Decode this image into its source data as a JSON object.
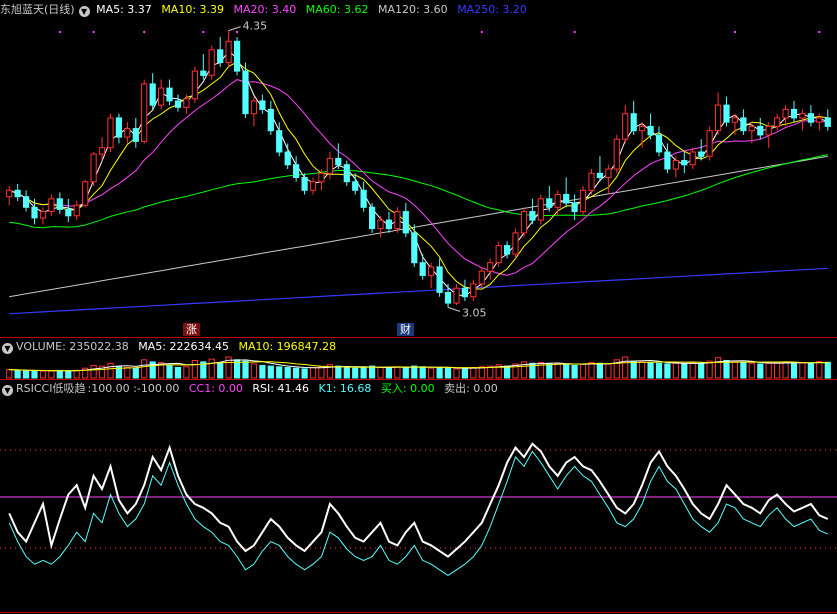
{
  "colors": {
    "up": "#ff3030",
    "down": "#54ffff",
    "ma5": "#ffffff",
    "ma10": "#ffff00",
    "ma20": "#ff44ff",
    "ma60": "#00ff00",
    "ma120": "#c8c8c8",
    "ma250": "#3838ff",
    "rsi": "#ffffff",
    "k1": "#54ffff",
    "cc1": "#ff44ff",
    "divider": "#c00000"
  },
  "main": {
    "title": "东旭蓝天(日线)",
    "ma5": "MA5: 3.37",
    "ma10": "MA10: 3.39",
    "ma20": "MA20: 3.40",
    "ma60": "MA60: 3.62",
    "ma120": "MA120: 3.60",
    "ma250": "MA250: 3.20",
    "high_label": "4.35",
    "low_label": "3.05",
    "tag_up": "涨",
    "tag_fin": "财"
  },
  "volume": {
    "title": "VOLUME: 235022.38",
    "ma5": "MA5: 222634.45",
    "ma10": "MA10: 196847.28"
  },
  "indicator": {
    "title": "RSICCI低吸趋",
    "params": ":100.00 :-100.00",
    "cc1": "CC1: 0.00",
    "rsi": "RSI: 41.46",
    "k1": "K1: 16.68",
    "buy": "买入: 0.00",
    "sell": "卖出: 0.00"
  },
  "chart_data": [
    {
      "type": "candlestick",
      "series_note": "approximate daily OHLC read from price chart",
      "ohlc": [
        [
          3.57,
          3.62,
          3.53,
          3.6
        ],
        [
          3.6,
          3.63,
          3.55,
          3.57
        ],
        [
          3.57,
          3.6,
          3.5,
          3.52
        ],
        [
          3.52,
          3.56,
          3.44,
          3.47
        ],
        [
          3.47,
          3.52,
          3.44,
          3.5
        ],
        [
          3.5,
          3.58,
          3.48,
          3.56
        ],
        [
          3.56,
          3.59,
          3.49,
          3.51
        ],
        [
          3.51,
          3.56,
          3.45,
          3.48
        ],
        [
          3.48,
          3.55,
          3.46,
          3.53
        ],
        [
          3.53,
          3.65,
          3.52,
          3.64
        ],
        [
          3.64,
          3.78,
          3.62,
          3.77
        ],
        [
          3.77,
          3.85,
          3.74,
          3.8
        ],
        [
          3.8,
          3.96,
          3.78,
          3.94
        ],
        [
          3.94,
          3.96,
          3.82,
          3.85
        ],
        [
          3.85,
          3.92,
          3.82,
          3.89
        ],
        [
          3.89,
          3.94,
          3.8,
          3.83
        ],
        [
          3.83,
          4.12,
          3.82,
          4.1
        ],
        [
          4.1,
          4.15,
          3.98,
          4.0
        ],
        [
          4.0,
          4.12,
          3.98,
          4.08
        ],
        [
          4.08,
          4.12,
          4.0,
          4.02
        ],
        [
          4.02,
          4.05,
          3.97,
          3.99
        ],
        [
          3.99,
          4.05,
          3.96,
          4.03
        ],
        [
          4.03,
          4.18,
          4.01,
          4.16
        ],
        [
          4.16,
          4.24,
          4.12,
          4.14
        ],
        [
          4.14,
          4.28,
          4.12,
          4.26
        ],
        [
          4.26,
          4.32,
          4.18,
          4.2
        ],
        [
          4.2,
          4.35,
          4.18,
          4.3
        ],
        [
          4.3,
          4.32,
          4.14,
          4.16
        ],
        [
          4.16,
          4.2,
          3.94,
          3.96
        ],
        [
          3.96,
          4.04,
          3.9,
          4.02
        ],
        [
          4.02,
          4.05,
          3.96,
          3.98
        ],
        [
          3.98,
          4.02,
          3.86,
          3.88
        ],
        [
          3.88,
          3.92,
          3.76,
          3.78
        ],
        [
          3.78,
          3.82,
          3.7,
          3.72
        ],
        [
          3.72,
          3.76,
          3.64,
          3.66
        ],
        [
          3.66,
          3.68,
          3.58,
          3.6
        ],
        [
          3.6,
          3.66,
          3.58,
          3.64
        ],
        [
          3.64,
          3.7,
          3.6,
          3.68
        ],
        [
          3.68,
          3.78,
          3.65,
          3.75
        ],
        [
          3.75,
          3.82,
          3.7,
          3.72
        ],
        [
          3.72,
          3.74,
          3.62,
          3.64
        ],
        [
          3.64,
          3.68,
          3.58,
          3.6
        ],
        [
          3.6,
          3.64,
          3.5,
          3.52
        ],
        [
          3.52,
          3.54,
          3.4,
          3.42
        ],
        [
          3.42,
          3.48,
          3.38,
          3.46
        ],
        [
          3.46,
          3.5,
          3.4,
          3.42
        ],
        [
          3.42,
          3.52,
          3.4,
          3.5
        ],
        [
          3.5,
          3.54,
          3.38,
          3.4
        ],
        [
          3.4,
          3.44,
          3.24,
          3.26
        ],
        [
          3.26,
          3.3,
          3.18,
          3.2
        ],
        [
          3.2,
          3.26,
          3.14,
          3.24
        ],
        [
          3.24,
          3.28,
          3.1,
          3.12
        ],
        [
          3.12,
          3.16,
          3.05,
          3.07
        ],
        [
          3.07,
          3.16,
          3.06,
          3.14
        ],
        [
          3.14,
          3.18,
          3.08,
          3.1
        ],
        [
          3.1,
          3.18,
          3.08,
          3.16
        ],
        [
          3.16,
          3.24,
          3.14,
          3.22
        ],
        [
          3.22,
          3.28,
          3.18,
          3.26
        ],
        [
          3.26,
          3.36,
          3.24,
          3.34
        ],
        [
          3.34,
          3.36,
          3.28,
          3.3
        ],
        [
          3.3,
          3.42,
          3.28,
          3.4
        ],
        [
          3.4,
          3.52,
          3.38,
          3.5
        ],
        [
          3.5,
          3.56,
          3.44,
          3.46
        ],
        [
          3.46,
          3.58,
          3.44,
          3.56
        ],
        [
          3.56,
          3.62,
          3.5,
          3.52
        ],
        [
          3.52,
          3.6,
          3.48,
          3.58
        ],
        [
          3.58,
          3.66,
          3.52,
          3.54
        ],
        [
          3.54,
          3.58,
          3.46,
          3.5
        ],
        [
          3.5,
          3.62,
          3.48,
          3.6
        ],
        [
          3.6,
          3.7,
          3.58,
          3.68
        ],
        [
          3.68,
          3.76,
          3.64,
          3.66
        ],
        [
          3.66,
          3.72,
          3.58,
          3.7
        ],
        [
          3.7,
          3.86,
          3.68,
          3.84
        ],
        [
          3.84,
          4.0,
          3.82,
          3.96
        ],
        [
          3.96,
          4.02,
          3.86,
          3.88
        ],
        [
          3.88,
          3.92,
          3.8,
          3.9
        ],
        [
          3.9,
          3.96,
          3.84,
          3.86
        ],
        [
          3.86,
          3.9,
          3.76,
          3.78
        ],
        [
          3.78,
          3.82,
          3.68,
          3.7
        ],
        [
          3.7,
          3.76,
          3.66,
          3.74
        ],
        [
          3.74,
          3.78,
          3.68,
          3.72
        ],
        [
          3.72,
          3.8,
          3.7,
          3.78
        ],
        [
          3.78,
          3.84,
          3.74,
          3.76
        ],
        [
          3.76,
          3.9,
          3.74,
          3.88
        ],
        [
          3.88,
          4.06,
          3.86,
          4.0
        ],
        [
          4.0,
          4.04,
          3.9,
          3.92
        ],
        [
          3.92,
          3.96,
          3.86,
          3.94
        ],
        [
          3.94,
          3.98,
          3.86,
          3.88
        ],
        [
          3.88,
          3.92,
          3.82,
          3.9
        ],
        [
          3.9,
          3.94,
          3.84,
          3.86
        ],
        [
          3.86,
          3.92,
          3.8,
          3.9
        ],
        [
          3.9,
          3.96,
          3.88,
          3.94
        ],
        [
          3.94,
          4.0,
          3.9,
          3.98
        ],
        [
          3.98,
          4.02,
          3.92,
          3.94
        ],
        [
          3.94,
          3.98,
          3.88,
          3.96
        ],
        [
          3.96,
          4.0,
          3.9,
          3.92
        ],
        [
          3.92,
          3.96,
          3.88,
          3.94
        ],
        [
          3.94,
          3.98,
          3.88,
          3.9
        ]
      ],
      "volume": [
        120,
        110,
        105,
        100,
        98,
        102,
        108,
        104,
        110,
        140,
        180,
        170,
        210,
        160,
        150,
        140,
        260,
        230,
        220,
        180,
        150,
        160,
        250,
        230,
        270,
        220,
        300,
        260,
        240,
        200,
        180,
        170,
        160,
        150,
        140,
        130,
        150,
        160,
        190,
        170,
        150,
        140,
        150,
        170,
        150,
        140,
        160,
        150,
        170,
        160,
        140,
        150,
        140,
        130,
        140,
        150,
        160,
        170,
        190,
        170,
        200,
        230,
        210,
        220,
        200,
        210,
        190,
        180,
        200,
        220,
        210,
        200,
        260,
        300,
        240,
        230,
        220,
        210,
        200,
        210,
        200,
        220,
        210,
        240,
        290,
        250,
        230,
        220,
        210,
        200,
        210,
        220,
        230,
        220,
        215,
        210,
        235,
        225
      ],
      "rsi": [
        45,
        35,
        30,
        40,
        50,
        28,
        42,
        55,
        60,
        48,
        65,
        58,
        70,
        52,
        45,
        50,
        60,
        75,
        68,
        80,
        65,
        55,
        50,
        48,
        45,
        40,
        38,
        30,
        25,
        28,
        35,
        42,
        38,
        32,
        28,
        25,
        30,
        35,
        50,
        45,
        38,
        32,
        30,
        35,
        40,
        30,
        28,
        35,
        40,
        30,
        28,
        25,
        22,
        26,
        30,
        35,
        40,
        50,
        60,
        72,
        80,
        75,
        82,
        78,
        70,
        65,
        72,
        75,
        70,
        68,
        62,
        55,
        48,
        45,
        50,
        60,
        72,
        78,
        70,
        65,
        58,
        50,
        45,
        42,
        50,
        60,
        55,
        50,
        48,
        45,
        52,
        55,
        50,
        46,
        48,
        50,
        44,
        42
      ],
      "k1": [
        40,
        30,
        22,
        18,
        20,
        18,
        22,
        28,
        35,
        30,
        45,
        40,
        55,
        45,
        38,
        42,
        50,
        65,
        60,
        72,
        60,
        50,
        42,
        38,
        35,
        30,
        28,
        22,
        15,
        18,
        25,
        30,
        28,
        22,
        18,
        15,
        18,
        22,
        35,
        32,
        26,
        22,
        20,
        22,
        28,
        20,
        18,
        22,
        28,
        20,
        18,
        15,
        12,
        15,
        18,
        22,
        28,
        38,
        50,
        62,
        75,
        70,
        78,
        72,
        65,
        58,
        65,
        70,
        65,
        62,
        55,
        48,
        40,
        38,
        42,
        50,
        62,
        70,
        62,
        58,
        50,
        42,
        38,
        35,
        40,
        50,
        48,
        42,
        40,
        38,
        44,
        48,
        42,
        38,
        40,
        42,
        36,
        34
      ],
      "price_axis": [
        3.0,
        4.4
      ],
      "cci_levels": [
        100,
        0,
        -100
      ]
    }
  ]
}
